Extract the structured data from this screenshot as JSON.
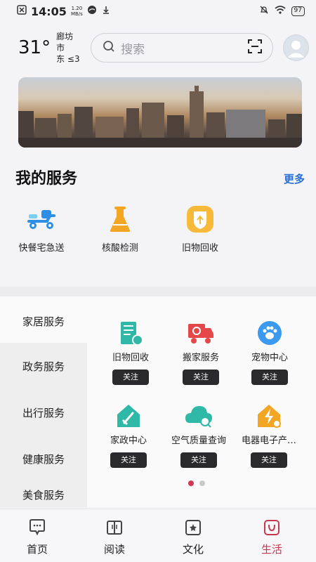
{
  "status_bar": {
    "time": "14:05",
    "net_speed_value": "1.20",
    "net_speed_unit": "MB/s",
    "battery": "97"
  },
  "header": {
    "temperature": "31°",
    "city": "廊坊市",
    "wind": "东  ≤3",
    "search_placeholder": "搜索"
  },
  "my_services": {
    "title": "我的服务",
    "more": "更多",
    "items": [
      {
        "label": "快餐宅急送",
        "icon": "scooter-icon"
      },
      {
        "label": "核酸检测",
        "icon": "flask-icon"
      },
      {
        "label": "旧物回收",
        "icon": "recycle-badge-icon"
      }
    ]
  },
  "categories": [
    {
      "label": "家居服务"
    },
    {
      "label": "政务服务"
    },
    {
      "label": "出行服务"
    },
    {
      "label": "健康服务"
    },
    {
      "label": "美食服务"
    }
  ],
  "grid_services": [
    {
      "label": "旧物回收",
      "follow": "关注",
      "icon": "recycle-building-icon"
    },
    {
      "label": "搬家服务",
      "follow": "关注",
      "icon": "moving-truck-icon"
    },
    {
      "label": "宠物中心",
      "follow": "关注",
      "icon": "paw-icon"
    },
    {
      "label": "家政中心",
      "follow": "关注",
      "icon": "housekeeping-icon"
    },
    {
      "label": "空气质量查询",
      "follow": "关注",
      "icon": "cloud-search-icon"
    },
    {
      "label": "电器电子产…",
      "follow": "关注",
      "icon": "electric-house-icon"
    }
  ],
  "pager": {
    "pages": 2,
    "active": 1
  },
  "tab_bar": {
    "items": [
      {
        "label": "首页",
        "icon": "home-icon"
      },
      {
        "label": "阅读",
        "icon": "book-icon"
      },
      {
        "label": "文化",
        "icon": "culture-icon"
      },
      {
        "label": "生活",
        "icon": "life-icon"
      }
    ],
    "active": 3
  },
  "colors": {
    "accent_red": "#c8374f",
    "link_blue": "#2a6fd6",
    "teal": "#2fb8a6",
    "orange": "#f2a623",
    "follow_bg": "#2a2a2c"
  }
}
